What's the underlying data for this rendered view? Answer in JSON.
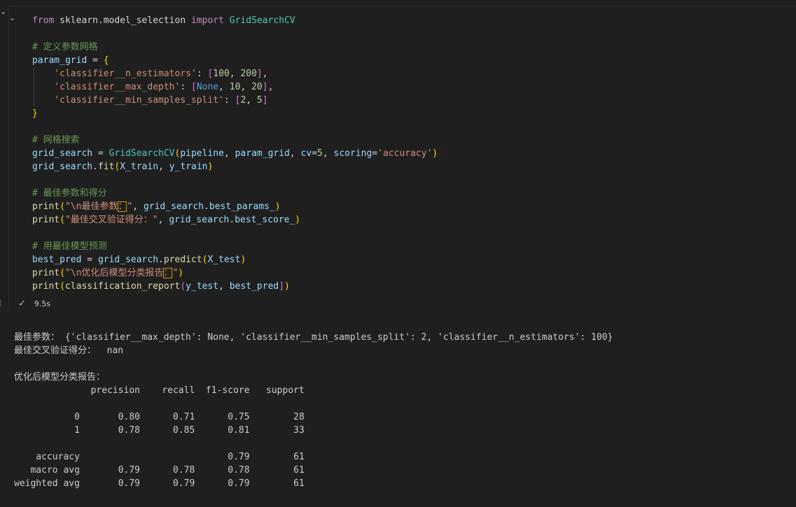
{
  "code_lines": [
    [
      [
        "kw",
        "from"
      ],
      [
        "pun",
        " sklearn.model_selection "
      ],
      [
        "kw",
        "import"
      ],
      [
        "pun",
        " "
      ],
      [
        "cls",
        "GridSearchCV"
      ]
    ],
    [],
    [
      [
        "cmt",
        "# 定义参数网格"
      ]
    ],
    [
      [
        "var",
        "param_grid"
      ],
      [
        "pun",
        " = "
      ],
      [
        "b1",
        "{"
      ]
    ],
    [
      [
        "pun",
        "    "
      ],
      [
        "str",
        "'classifier__n_estimators'"
      ],
      [
        "pun",
        ": "
      ],
      [
        "b2",
        "["
      ],
      [
        "num",
        "100"
      ],
      [
        "pun",
        ", "
      ],
      [
        "num",
        "200"
      ],
      [
        "b2",
        "]"
      ],
      [
        "pun",
        ","
      ]
    ],
    [
      [
        "pun",
        "    "
      ],
      [
        "str",
        "'classifier__max_depth'"
      ],
      [
        "pun",
        ": "
      ],
      [
        "b2",
        "["
      ],
      [
        "cst",
        "None"
      ],
      [
        "pun",
        ", "
      ],
      [
        "num",
        "10"
      ],
      [
        "pun",
        ", "
      ],
      [
        "num",
        "20"
      ],
      [
        "b2",
        "]"
      ],
      [
        "pun",
        ","
      ]
    ],
    [
      [
        "pun",
        "    "
      ],
      [
        "str",
        "'classifier__min_samples_split'"
      ],
      [
        "pun",
        ": "
      ],
      [
        "b2",
        "["
      ],
      [
        "num",
        "2"
      ],
      [
        "pun",
        ", "
      ],
      [
        "num",
        "5"
      ],
      [
        "b2",
        "]"
      ]
    ],
    [
      [
        "b1",
        "}"
      ]
    ],
    [],
    [
      [
        "cmt",
        "# 网格搜索"
      ]
    ],
    [
      [
        "var",
        "grid_search"
      ],
      [
        "pun",
        " = "
      ],
      [
        "cls",
        "GridSearchCV"
      ],
      [
        "b1",
        "("
      ],
      [
        "var",
        "pipeline"
      ],
      [
        "pun",
        ", "
      ],
      [
        "var",
        "param_grid"
      ],
      [
        "pun",
        ", "
      ],
      [
        "var",
        "cv"
      ],
      [
        "pun",
        "="
      ],
      [
        "num",
        "5"
      ],
      [
        "pun",
        ", "
      ],
      [
        "var",
        "scoring"
      ],
      [
        "pun",
        "="
      ],
      [
        "str",
        "'accuracy'"
      ],
      [
        "b1",
        ")"
      ]
    ],
    [
      [
        "var",
        "grid_search"
      ],
      [
        "pun",
        "."
      ],
      [
        "fn",
        "fit"
      ],
      [
        "b1",
        "("
      ],
      [
        "var",
        "X_train"
      ],
      [
        "pun",
        ", "
      ],
      [
        "var",
        "y_train"
      ],
      [
        "b1",
        ")"
      ]
    ],
    [],
    [
      [
        "cmt",
        "# 最佳参数和得分"
      ]
    ],
    [
      [
        "fn",
        "print"
      ],
      [
        "b1",
        "("
      ],
      [
        "str",
        "\"\\n最佳参数"
      ],
      [
        "strbox",
        "："
      ],
      [
        "str",
        "\""
      ],
      [
        "pun",
        ", "
      ],
      [
        "var",
        "grid_search"
      ],
      [
        "pun",
        "."
      ],
      [
        "var",
        "best_params_"
      ],
      [
        "b1",
        ")"
      ]
    ],
    [
      [
        "fn",
        "print"
      ],
      [
        "b1",
        "("
      ],
      [
        "str",
        "\"最佳交叉验证得分：\""
      ],
      [
        "pun",
        ", "
      ],
      [
        "var",
        "grid_search"
      ],
      [
        "pun",
        "."
      ],
      [
        "var",
        "best_score_"
      ],
      [
        "b1",
        ")"
      ]
    ],
    [],
    [
      [
        "cmt",
        "# 用最佳模型预测"
      ]
    ],
    [
      [
        "var",
        "best_pred"
      ],
      [
        "pun",
        " = "
      ],
      [
        "var",
        "grid_search"
      ],
      [
        "pun",
        "."
      ],
      [
        "fn",
        "predict"
      ],
      [
        "b1",
        "("
      ],
      [
        "var",
        "X_test"
      ],
      [
        "b1",
        ")"
      ]
    ],
    [
      [
        "fn",
        "print"
      ],
      [
        "b1",
        "("
      ],
      [
        "str",
        "\"\\n优化后模型分类报告"
      ],
      [
        "strbox",
        "："
      ],
      [
        "str",
        "\""
      ],
      [
        "b1",
        ")"
      ]
    ],
    [
      [
        "fn",
        "print"
      ],
      [
        "b1",
        "("
      ],
      [
        "fn",
        "classification_report"
      ],
      [
        "b2",
        "("
      ],
      [
        "var",
        "y_test"
      ],
      [
        "pun",
        ", "
      ],
      [
        "var",
        "best_pred"
      ],
      [
        "b2",
        "]"
      ],
      [
        "b1",
        ")"
      ]
    ]
  ],
  "status": {
    "duration": "9.5s"
  },
  "output_lines": [
    "最佳参数： {'classifier__max_depth': None, 'classifier__min_samples_split': 2, 'classifier__n_estimators': 100}",
    "最佳交叉验证得分：  nan",
    "",
    "优化后模型分类报告：",
    "              precision    recall  f1-score   support",
    "",
    "           0       0.80      0.71      0.75        28",
    "           1       0.78      0.85      0.81        33",
    "",
    "    accuracy                           0.79        61",
    "   macro avg       0.79      0.78      0.78        61",
    "weighted avg       0.79      0.79      0.79        61"
  ]
}
